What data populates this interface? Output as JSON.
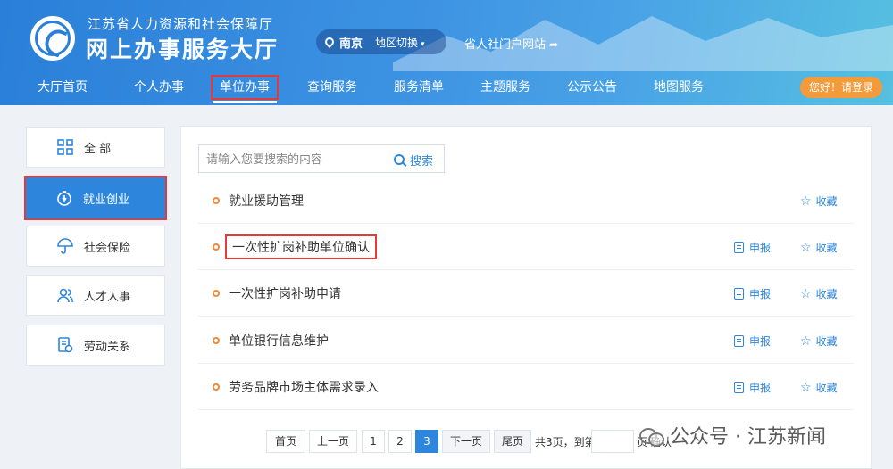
{
  "header": {
    "org_name": "江苏省人力资源和社会保障厅",
    "site_title": "网上办事服务大厅",
    "region": {
      "city": "南京",
      "switch_label": "地区切换",
      "caret": "▾"
    },
    "portal_link": "省人社门户网站",
    "login_label": "您好！请登录"
  },
  "nav": {
    "items": [
      {
        "label": "大厅首页"
      },
      {
        "label": "个人办事"
      },
      {
        "label": "单位办事",
        "active": true
      },
      {
        "label": "查询服务"
      },
      {
        "label": "服务清单"
      },
      {
        "label": "主题服务"
      },
      {
        "label": "公示公告"
      },
      {
        "label": "地图服务"
      }
    ]
  },
  "sidebar": {
    "items": [
      {
        "label": "全 部",
        "icon": "grid-icon"
      },
      {
        "label": "就业创业",
        "icon": "employment-icon",
        "active": true
      },
      {
        "label": "社会保险",
        "icon": "umbrella-icon"
      },
      {
        "label": "人才人事",
        "icon": "people-icon"
      },
      {
        "label": "劳动关系",
        "icon": "contract-icon"
      }
    ]
  },
  "search": {
    "placeholder": "请输入您要搜索的内容",
    "button_label": "搜索"
  },
  "services": [
    {
      "label": "就业援助管理",
      "apply": "",
      "favorite": "收藏"
    },
    {
      "label": "一次性扩岗补助单位确认",
      "apply": "申报",
      "favorite": "收藏",
      "highlighted": true
    },
    {
      "label": "一次性扩岗补助申请",
      "apply": "申报",
      "favorite": "收藏"
    },
    {
      "label": "单位银行信息维护",
      "apply": "申报",
      "favorite": "收藏"
    },
    {
      "label": "劳务品牌市场主体需求录入",
      "apply": "申报",
      "favorite": "收藏"
    }
  ],
  "pagination": {
    "first": "首页",
    "prev": "上一页",
    "pages": [
      "1",
      "2",
      "3"
    ],
    "current": "3",
    "next": "下一页",
    "last": "尾页",
    "summary": "共3页，到第",
    "page_unit": "页",
    "confirm": "确认"
  },
  "watermark": {
    "text": "公众号 · 江苏新闻"
  },
  "colors": {
    "primary": "#2e86dc",
    "accent_orange": "#f39b3a",
    "highlight_red": "#e23b3b"
  }
}
